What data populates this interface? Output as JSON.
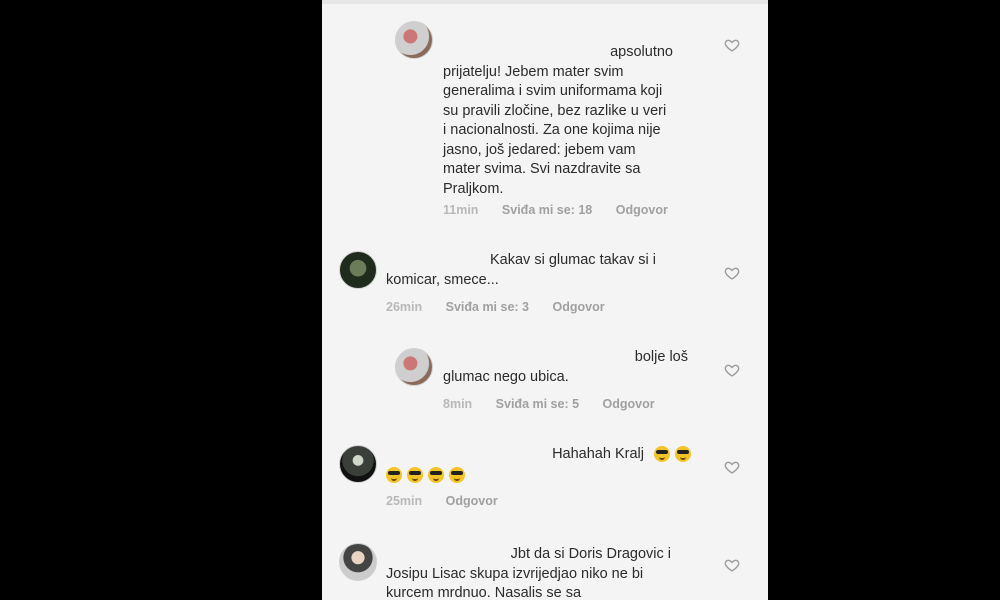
{
  "comments": [
    {
      "first_line": "apsolutno",
      "body": "prijatelju! Jebem mater svim generalima i svim uniformama koji su pravili zločine, bez razlike u veri i nacionalnosti. Za one kojima nije jasno, još jedared: jebem vam mater svima.  Svi nazdravite sa Praljkom.",
      "time": "11min",
      "likes": "Sviđa mi se: 18",
      "reply": "Odgovor"
    },
    {
      "first_line": "Kakav si glumac takav si i",
      "body": "komicar, smece...",
      "time": "26min",
      "likes": "Sviđa mi se: 3",
      "reply": "Odgovor"
    },
    {
      "first_line": "bolje loš",
      "body": "glumac nego ubica.",
      "time": "8min",
      "likes": "Sviđa mi se: 5",
      "reply": "Odgovor"
    },
    {
      "first_line": "Hahahah Kralj",
      "time": "25min",
      "reply": "Odgovor"
    },
    {
      "first_line": "Jbt da si Doris Dragovic i",
      "body": "Josipu Lisac skupa izvrijedjao niko ne bi kurcem mrdnuo. Nasalis se sa"
    }
  ]
}
